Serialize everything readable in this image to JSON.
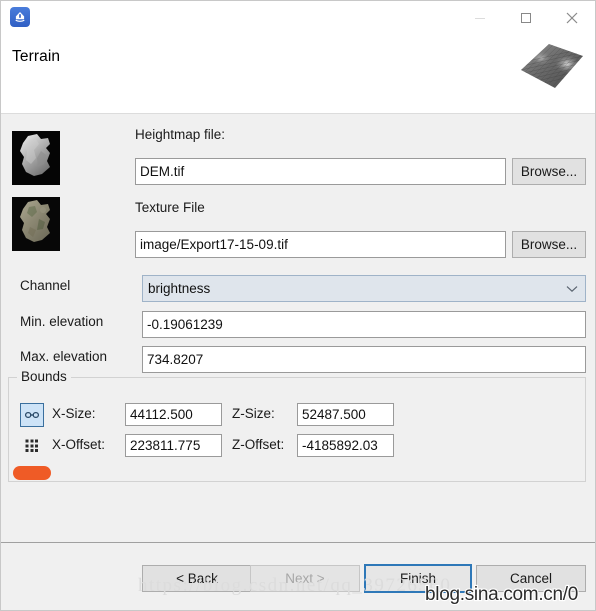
{
  "window": {
    "app_icon": "terrain-app-icon",
    "controls": [
      {
        "name": "minimize",
        "glyph": "minimize-icon"
      },
      {
        "name": "maximize",
        "glyph": "maximize-icon"
      },
      {
        "name": "close",
        "glyph": "close-icon"
      }
    ]
  },
  "header": {
    "title": "Terrain",
    "thumbnail": "terrain-surface-preview"
  },
  "form": {
    "heightmap": {
      "label": "Heightmap file:",
      "value": "DEM.tif",
      "browse_label": "Browse...",
      "thumbnail": "heightmap-thumbnail"
    },
    "texture": {
      "label": "Texture File",
      "value": "image/Export17-15-09.tif",
      "browse_label": "Browse...",
      "thumbnail": "texture-thumbnail"
    },
    "channel": {
      "label": "Channel",
      "value": "brightness",
      "arrow": "chevron-down-icon"
    },
    "min_elevation": {
      "label": "Min. elevation",
      "value": "-0.19061239"
    },
    "max_elevation": {
      "label": "Max. elevation",
      "value": "734.8207"
    }
  },
  "bounds": {
    "legend": "Bounds",
    "link_icon": "link-chain-icon",
    "grid_icon": "grid-icon",
    "x_size": {
      "label": "X-Size:",
      "value": "44112.500"
    },
    "z_size": {
      "label": "Z-Size:",
      "value": "52487.500"
    },
    "x_offset": {
      "label": "X-Offset:",
      "value": "223811.775"
    },
    "z_offset": {
      "label": "Z-Offset:",
      "value": "-4185892.03"
    }
  },
  "footer": {
    "back": "< Back",
    "next": "Next >",
    "finish": "Finish",
    "cancel": "Cancel"
  },
  "watermarks": {
    "csdn": "https://blog.csdn.net/qq_39726560",
    "sina": "blog.sina.com.cn/0"
  },
  "colors": {
    "accent": "#2e78b8",
    "highlight": "#ef5b26",
    "window_bg": "#f0f0f0",
    "field_bg": "#ffffff"
  }
}
